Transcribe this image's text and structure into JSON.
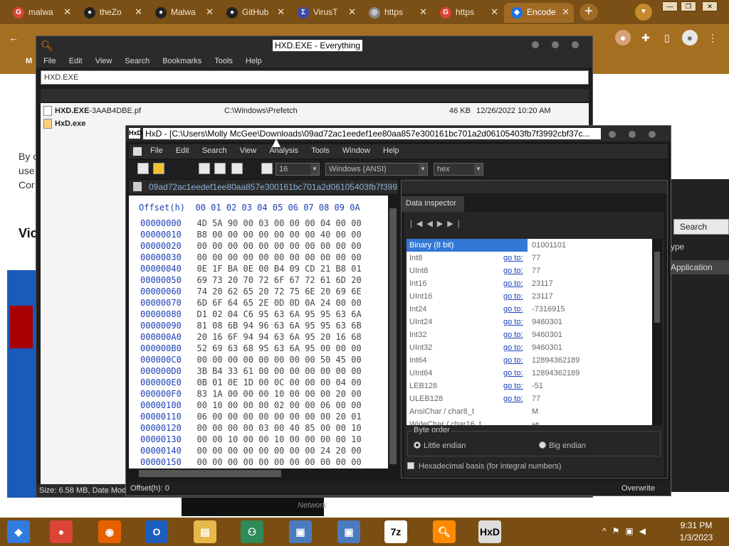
{
  "browser": {
    "tabs": [
      {
        "label": "malwa",
        "icon": "google-icon",
        "color": "#db4437"
      },
      {
        "label": "theZo",
        "icon": "github-icon",
        "color": "#222222"
      },
      {
        "label": "Malwa",
        "icon": "github-icon",
        "color": "#222222"
      },
      {
        "label": "GitHub",
        "icon": "github-icon",
        "color": "#222222"
      },
      {
        "label": "VirusT",
        "icon": "virustotal-icon",
        "color": "#3949ab"
      },
      {
        "label": "https",
        "icon": "globe-icon",
        "color": "#888888"
      },
      {
        "label": "https",
        "icon": "google-icon",
        "color": "#db4437"
      },
      {
        "label": "Encode",
        "icon": "encode-icon",
        "color": "#1a73e8"
      }
    ],
    "page_text": [
      "By c",
      "use",
      "Cor"
    ],
    "page_heading": "Vic",
    "bookmark_letter": "M",
    "search_button": "Search",
    "type_label": "ype",
    "application_label": "Application",
    "network_label": "Network"
  },
  "everything": {
    "title": "HXD.EXE - Everything",
    "menu": [
      "File",
      "Edit",
      "View",
      "Search",
      "Bookmarks",
      "Tools",
      "Help"
    ],
    "search_value": "HXD.EXE",
    "results": [
      {
        "name": "HXD.EXE",
        "suffix": "-3AAB4DBE.pf",
        "path": "C:\\Windows\\Prefetch",
        "size": "46 KB",
        "date": "12/26/2022 10:20 AM"
      },
      {
        "name": "HxD.exe",
        "suffix": "",
        "path": "",
        "size": "",
        "date": ""
      }
    ],
    "status": "Size: 6.58 MB, Date Modi"
  },
  "hxd": {
    "title": "HxD - [C:\\Users\\Molly McGee\\Downloads\\09ad72ac1eedef1ee80aa857e300161bc701a2d06105403fb7f3992cbf37c...",
    "menu": [
      "File",
      "Edit",
      "Search",
      "View",
      "Analysis",
      "Tools",
      "Window",
      "Help"
    ],
    "bytes_per_row": "16",
    "charset": "Windows (ANSI)",
    "offset_base": "hex",
    "file_tab": "09ad72ac1eedef1ee80aa857e300161bc701a2d06105403fb7f3992",
    "hex_header": "Offset(h)  00 01 02 03 04 05 06 07 08 09 0A",
    "hex_rows": [
      {
        "offset": "00000000",
        "bytes": "4D 5A 90 00 03 00 00 00 04 00 00"
      },
      {
        "offset": "00000010",
        "bytes": "B8 00 00 00 00 00 00 00 40 00 00"
      },
      {
        "offset": "00000020",
        "bytes": "00 00 00 00 00 00 00 00 00 00 00"
      },
      {
        "offset": "00000030",
        "bytes": "00 00 00 00 00 00 00 00 00 00 00"
      },
      {
        "offset": "00000040",
        "bytes": "0E 1F BA 0E 00 B4 09 CD 21 B8 01"
      },
      {
        "offset": "00000050",
        "bytes": "69 73 20 70 72 6F 67 72 61 6D 20"
      },
      {
        "offset": "00000060",
        "bytes": "74 20 62 65 20 72 75 6E 20 69 6E"
      },
      {
        "offset": "00000070",
        "bytes": "6D 6F 64 65 2E 0D 0D 0A 24 00 00"
      },
      {
        "offset": "00000080",
        "bytes": "D1 02 04 C6 95 63 6A 95 95 63 6A"
      },
      {
        "offset": "00000090",
        "bytes": "81 08 6B 94 96 63 6A 95 95 63 6B"
      },
      {
        "offset": "000000A0",
        "bytes": "20 16 6F 94 94 63 6A 95 20 16 68"
      },
      {
        "offset": "000000B0",
        "bytes": "52 69 63 68 95 63 6A 95 00 00 00"
      },
      {
        "offset": "000000C0",
        "bytes": "00 00 00 00 00 00 00 00 50 45 00"
      },
      {
        "offset": "000000D0",
        "bytes": "3B B4 33 61 00 00 00 00 00 00 00"
      },
      {
        "offset": "000000E0",
        "bytes": "0B 01 0E 1D 00 0C 00 00 00 04 00"
      },
      {
        "offset": "000000F0",
        "bytes": "83 1A 00 00 00 10 00 00 00 20 00"
      },
      {
        "offset": "00000100",
        "bytes": "00 10 00 00 00 02 00 00 06 00 00"
      },
      {
        "offset": "00000110",
        "bytes": "06 00 00 00 00 00 00 00 00 20 01"
      },
      {
        "offset": "00000120",
        "bytes": "00 00 00 00 03 00 40 85 00 00 10"
      },
      {
        "offset": "00000130",
        "bytes": "00 00 10 00 00 10 00 00 00 00 10"
      },
      {
        "offset": "00000140",
        "bytes": "00 00 00 00 00 00 00 00 24 20 00"
      },
      {
        "offset": "00000150",
        "bytes": "00 00 00 00 00 00 00 00 00 00 00"
      }
    ],
    "data_inspector": {
      "tab": "Data inspector",
      "goto_label": "go to:",
      "rows": [
        {
          "type": "Binary (8 bit)",
          "goto": false,
          "value": "01001101",
          "selected": true
        },
        {
          "type": "Int8",
          "goto": true,
          "value": "77"
        },
        {
          "type": "UInt8",
          "goto": true,
          "value": "77"
        },
        {
          "type": "Int16",
          "goto": true,
          "value": "23117"
        },
        {
          "type": "UInt16",
          "goto": true,
          "value": "23117"
        },
        {
          "type": "Int24",
          "goto": true,
          "value": "-7316915"
        },
        {
          "type": "UInt24",
          "goto": true,
          "value": "9460301"
        },
        {
          "type": "Int32",
          "goto": true,
          "value": "9460301"
        },
        {
          "type": "UInt32",
          "goto": true,
          "value": "9460301"
        },
        {
          "type": "Int64",
          "goto": true,
          "value": "12894362189"
        },
        {
          "type": "UInt64",
          "goto": true,
          "value": "12894362189"
        },
        {
          "type": "LEB128",
          "goto": true,
          "value": "-51"
        },
        {
          "type": "ULEB128",
          "goto": true,
          "value": "77"
        },
        {
          "type": "AnsiChar / char8_t",
          "goto": false,
          "value": "M"
        },
        {
          "type": "WideChar / char16_t",
          "goto": false,
          "value": "婍"
        }
      ],
      "byte_order_label": "Byte order",
      "little_endian": "Little endian",
      "big_endian": "Big endian",
      "hex_basis_label": "Hexadecimal basis (for integral numbers)"
    },
    "status_offset": "Offset(h): 0",
    "status_mode": "Overwrite"
  },
  "taskbar": {
    "apps": [
      "chrome-apps-icon",
      "chrome-icon",
      "firefox-icon",
      "opera-icon",
      "file-explorer-icon",
      "network-icon",
      "installer-icon",
      "installer2-icon",
      "7zip-icon",
      "everything-icon",
      "hxd-icon"
    ],
    "time": "9:31 PM",
    "date": "1/3/2023"
  }
}
